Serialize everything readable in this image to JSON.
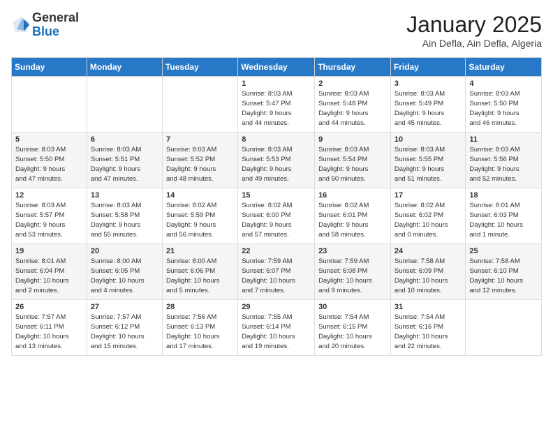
{
  "header": {
    "logo_general": "General",
    "logo_blue": "Blue",
    "month": "January 2025",
    "location": "Ain Defla, Ain Defla, Algeria"
  },
  "calendar": {
    "days_of_week": [
      "Sunday",
      "Monday",
      "Tuesday",
      "Wednesday",
      "Thursday",
      "Friday",
      "Saturday"
    ],
    "weeks": [
      [
        {
          "day": "",
          "info": ""
        },
        {
          "day": "",
          "info": ""
        },
        {
          "day": "",
          "info": ""
        },
        {
          "day": "1",
          "info": "Sunrise: 8:03 AM\nSunset: 5:47 PM\nDaylight: 9 hours\nand 44 minutes."
        },
        {
          "day": "2",
          "info": "Sunrise: 8:03 AM\nSunset: 5:48 PM\nDaylight: 9 hours\nand 44 minutes."
        },
        {
          "day": "3",
          "info": "Sunrise: 8:03 AM\nSunset: 5:49 PM\nDaylight: 9 hours\nand 45 minutes."
        },
        {
          "day": "4",
          "info": "Sunrise: 8:03 AM\nSunset: 5:50 PM\nDaylight: 9 hours\nand 46 minutes."
        }
      ],
      [
        {
          "day": "5",
          "info": "Sunrise: 8:03 AM\nSunset: 5:50 PM\nDaylight: 9 hours\nand 47 minutes."
        },
        {
          "day": "6",
          "info": "Sunrise: 8:03 AM\nSunset: 5:51 PM\nDaylight: 9 hours\nand 47 minutes."
        },
        {
          "day": "7",
          "info": "Sunrise: 8:03 AM\nSunset: 5:52 PM\nDaylight: 9 hours\nand 48 minutes."
        },
        {
          "day": "8",
          "info": "Sunrise: 8:03 AM\nSunset: 5:53 PM\nDaylight: 9 hours\nand 49 minutes."
        },
        {
          "day": "9",
          "info": "Sunrise: 8:03 AM\nSunset: 5:54 PM\nDaylight: 9 hours\nand 50 minutes."
        },
        {
          "day": "10",
          "info": "Sunrise: 8:03 AM\nSunset: 5:55 PM\nDaylight: 9 hours\nand 51 minutes."
        },
        {
          "day": "11",
          "info": "Sunrise: 8:03 AM\nSunset: 5:56 PM\nDaylight: 9 hours\nand 52 minutes."
        }
      ],
      [
        {
          "day": "12",
          "info": "Sunrise: 8:03 AM\nSunset: 5:57 PM\nDaylight: 9 hours\nand 53 minutes."
        },
        {
          "day": "13",
          "info": "Sunrise: 8:03 AM\nSunset: 5:58 PM\nDaylight: 9 hours\nand 55 minutes."
        },
        {
          "day": "14",
          "info": "Sunrise: 8:02 AM\nSunset: 5:59 PM\nDaylight: 9 hours\nand 56 minutes."
        },
        {
          "day": "15",
          "info": "Sunrise: 8:02 AM\nSunset: 6:00 PM\nDaylight: 9 hours\nand 57 minutes."
        },
        {
          "day": "16",
          "info": "Sunrise: 8:02 AM\nSunset: 6:01 PM\nDaylight: 9 hours\nand 58 minutes."
        },
        {
          "day": "17",
          "info": "Sunrise: 8:02 AM\nSunset: 6:02 PM\nDaylight: 10 hours\nand 0 minutes."
        },
        {
          "day": "18",
          "info": "Sunrise: 8:01 AM\nSunset: 6:03 PM\nDaylight: 10 hours\nand 1 minute."
        }
      ],
      [
        {
          "day": "19",
          "info": "Sunrise: 8:01 AM\nSunset: 6:04 PM\nDaylight: 10 hours\nand 2 minutes."
        },
        {
          "day": "20",
          "info": "Sunrise: 8:00 AM\nSunset: 6:05 PM\nDaylight: 10 hours\nand 4 minutes."
        },
        {
          "day": "21",
          "info": "Sunrise: 8:00 AM\nSunset: 6:06 PM\nDaylight: 10 hours\nand 5 minutes."
        },
        {
          "day": "22",
          "info": "Sunrise: 7:59 AM\nSunset: 6:07 PM\nDaylight: 10 hours\nand 7 minutes."
        },
        {
          "day": "23",
          "info": "Sunrise: 7:59 AM\nSunset: 6:08 PM\nDaylight: 10 hours\nand 9 minutes."
        },
        {
          "day": "24",
          "info": "Sunrise: 7:58 AM\nSunset: 6:09 PM\nDaylight: 10 hours\nand 10 minutes."
        },
        {
          "day": "25",
          "info": "Sunrise: 7:58 AM\nSunset: 6:10 PM\nDaylight: 10 hours\nand 12 minutes."
        }
      ],
      [
        {
          "day": "26",
          "info": "Sunrise: 7:57 AM\nSunset: 6:11 PM\nDaylight: 10 hours\nand 13 minutes."
        },
        {
          "day": "27",
          "info": "Sunrise: 7:57 AM\nSunset: 6:12 PM\nDaylight: 10 hours\nand 15 minutes."
        },
        {
          "day": "28",
          "info": "Sunrise: 7:56 AM\nSunset: 6:13 PM\nDaylight: 10 hours\nand 17 minutes."
        },
        {
          "day": "29",
          "info": "Sunrise: 7:55 AM\nSunset: 6:14 PM\nDaylight: 10 hours\nand 19 minutes."
        },
        {
          "day": "30",
          "info": "Sunrise: 7:54 AM\nSunset: 6:15 PM\nDaylight: 10 hours\nand 20 minutes."
        },
        {
          "day": "31",
          "info": "Sunrise: 7:54 AM\nSunset: 6:16 PM\nDaylight: 10 hours\nand 22 minutes."
        },
        {
          "day": "",
          "info": ""
        }
      ]
    ]
  }
}
